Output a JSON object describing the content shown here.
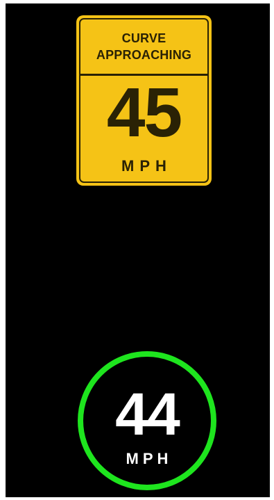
{
  "advisory_sign": {
    "line1": "CURVE",
    "line2": "APPROACHING",
    "speed_limit": "45",
    "unit": "MPH",
    "color": "#f5c316"
  },
  "current_speed": {
    "value": "44",
    "unit": "MPH",
    "ring_color": "#1ee51e"
  }
}
